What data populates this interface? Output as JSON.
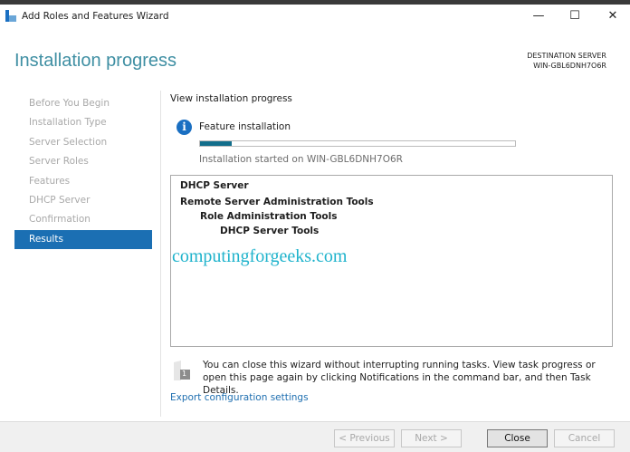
{
  "window": {
    "title": "Add Roles and Features Wizard",
    "minimize": "—",
    "maximize": "☐",
    "close": "✕"
  },
  "header": {
    "heading": "Installation progress",
    "dest_label": "DESTINATION SERVER",
    "dest_server": "WIN-GBL6DNH7O6R"
  },
  "sidebar": {
    "items": [
      {
        "label": "Before You Begin"
      },
      {
        "label": "Installation Type"
      },
      {
        "label": "Server Selection"
      },
      {
        "label": "Server Roles"
      },
      {
        "label": "Features"
      },
      {
        "label": "DHCP Server"
      },
      {
        "label": "Confirmation"
      },
      {
        "label": "Results",
        "active": true
      }
    ]
  },
  "main": {
    "section_label": "View installation progress",
    "info_icon": "i",
    "status": "Feature installation",
    "progress_percent": 10,
    "progress_color": "#126e8b",
    "started": "Installation started on WIN-GBL6DNH7O6R",
    "results": [
      "DHCP Server",
      "Remote Server Administration Tools",
      "Role Administration Tools",
      "DHCP Server Tools"
    ],
    "watermark": "computingforgeeks.com",
    "note_badge": "1",
    "note": "You can close this wizard without interrupting running tasks. View task progress or open this page again by clicking Notifications in the command bar, and then Task Details.",
    "export_link": "Export configuration settings"
  },
  "footer": {
    "previous": "< Previous",
    "next": "Next >",
    "close": "Close",
    "cancel": "Cancel"
  }
}
